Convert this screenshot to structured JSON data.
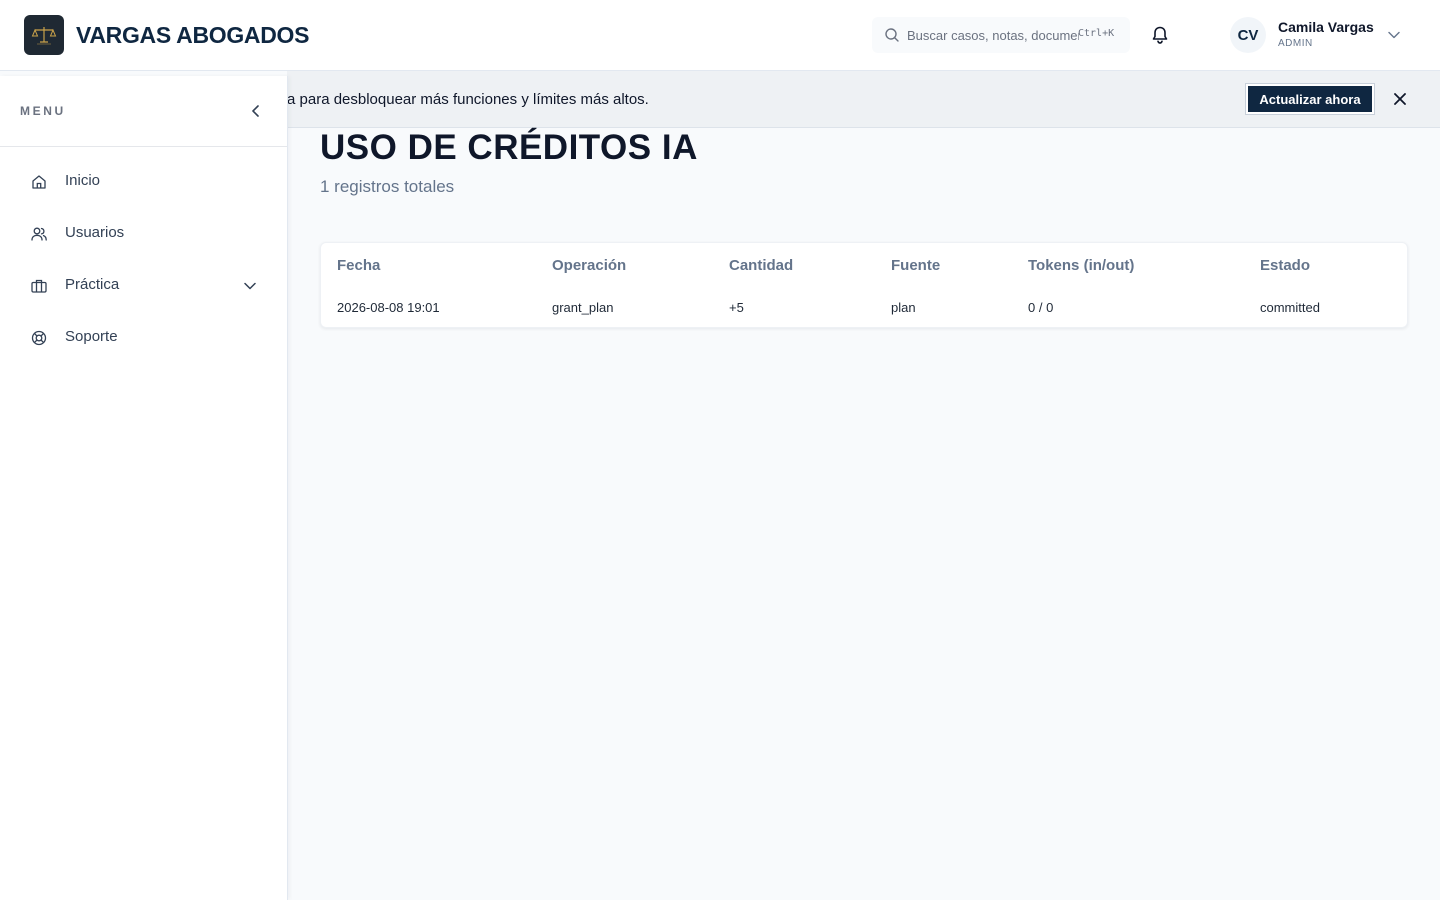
{
  "header": {
    "brand": "VARGAS ABOGADOS",
    "search_placeholder": "Buscar casos, notas, documentos...",
    "search_shortcut": "Ctrl+K",
    "user": {
      "initials": "CV",
      "name": "Camila Vargas",
      "role": "ADMIN"
    }
  },
  "banner": {
    "text": "a para desbloquear más funciones y límites más altos.",
    "button_label": "Actualizar ahora"
  },
  "sidebar": {
    "menu_label": "MENU",
    "items": [
      {
        "label": "Inicio",
        "icon": "home-icon"
      },
      {
        "label": "Usuarios",
        "icon": "users-icon"
      },
      {
        "label": "Práctica",
        "icon": "briefcase-icon"
      },
      {
        "label": "Soporte",
        "icon": "lifebuoy-icon"
      }
    ]
  },
  "main": {
    "title": "USO DE CRÉDITOS IA",
    "subtitle": "1 registros totales",
    "table": {
      "columns": [
        "Fecha",
        "Operación",
        "Cantidad",
        "Fuente",
        "Tokens (in/out)",
        "Estado"
      ],
      "rows": [
        [
          "2026-08-08 19:01",
          "grant_plan",
          "+5",
          "plan",
          "0 / 0",
          "committed"
        ]
      ]
    }
  },
  "colors": {
    "brand_navy": "#0f2741",
    "background": "#f8fafc"
  }
}
